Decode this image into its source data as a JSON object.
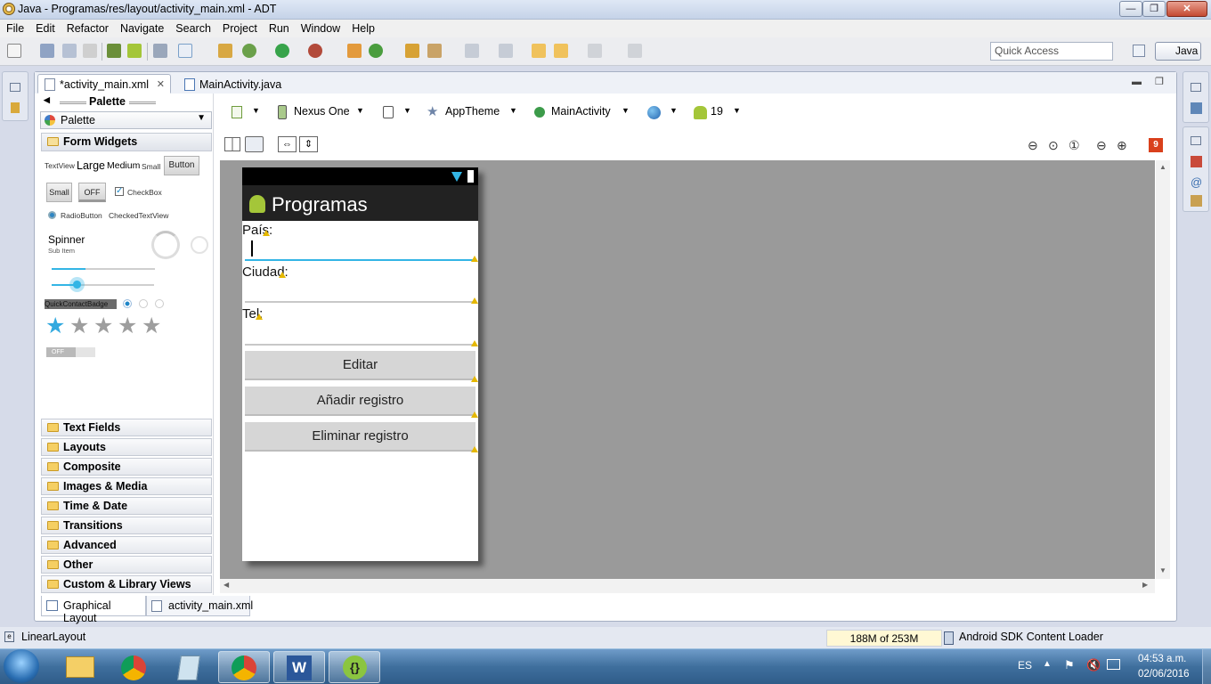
{
  "window": {
    "title": "Java - Programas/res/layout/activity_main.xml - ADT"
  },
  "menu": [
    "File",
    "Edit",
    "Refactor",
    "Navigate",
    "Search",
    "Project",
    "Run",
    "Window",
    "Help"
  ],
  "toolbar": {
    "quick_access_placeholder": "Quick Access",
    "perspective": "Java"
  },
  "editor_tabs": [
    {
      "label": "*activity_main.xml",
      "active": true
    },
    {
      "label": "MainActivity.java",
      "active": false
    }
  ],
  "palette": {
    "header": "Palette",
    "selector": "Palette",
    "open_category": "Form Widgets",
    "widgets": {
      "textview": "TextView",
      "large": "Large",
      "medium": "Medium",
      "small_text": "Small",
      "button": "Button",
      "small_btn": "Small",
      "toggle_off": "OFF",
      "checkbox": "CheckBox",
      "radiobutton": "RadioButton",
      "checkedtextview": "CheckedTextView",
      "spinner": "Spinner",
      "sub_item": "Sub Item",
      "quick_contact_badge": "QuickContactBadge",
      "switch_off": "OFF"
    },
    "categories": [
      "Text Fields",
      "Layouts",
      "Composite",
      "Images & Media",
      "Time & Date",
      "Transitions",
      "Advanced",
      "Other",
      "Custom & Library Views"
    ]
  },
  "design_toolbar": {
    "device": "Nexus One",
    "theme": "AppTheme",
    "activity": "MainActivity",
    "api": "19",
    "error_count": "9"
  },
  "device_preview": {
    "app_title": "Programas",
    "labels": [
      "País:",
      "Ciudad:",
      "Tel:"
    ],
    "buttons": [
      "Editar",
      "Añadir registro",
      "Eliminar registro"
    ]
  },
  "bottom_tabs": [
    {
      "label": "Graphical Layout",
      "active": true
    },
    {
      "label": "activity_main.xml",
      "active": false
    }
  ],
  "status": {
    "selection": "LinearLayout",
    "heap": "188M of 253M",
    "loader": "Android SDK Content Loader"
  },
  "taskbar": {
    "language": "ES",
    "time": "04:53 a.m.",
    "date": "02/06/2016"
  },
  "colors": {
    "accent_blue": "#33b5e5",
    "android_green": "#a4c639",
    "warning": "#e5b800",
    "error": "#d9401c"
  }
}
